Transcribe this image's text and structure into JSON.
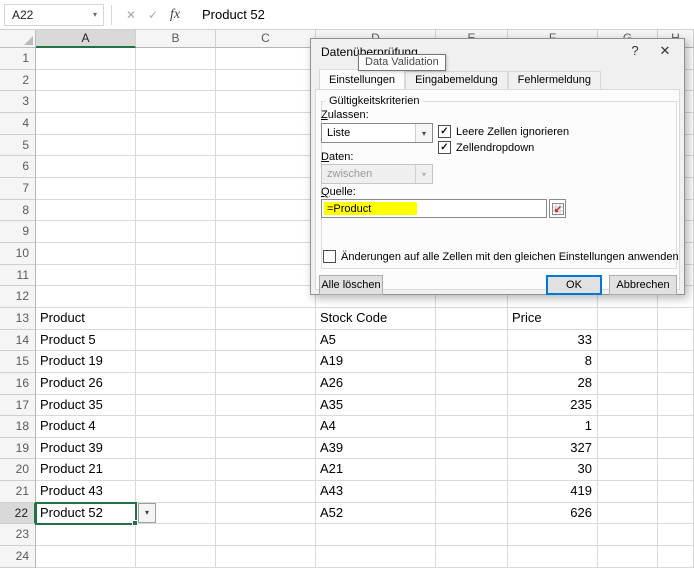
{
  "icons": {
    "dropdown_arrow": "▾",
    "cancel": "✕",
    "enter": "✓",
    "fx": "fx",
    "check": "✓",
    "help": "?",
    "close": "✕"
  },
  "formula_bar": {
    "name_box": "A22",
    "formula": "Product 52"
  },
  "sheet": {
    "col_headers": [
      "A",
      "B",
      "C",
      "D",
      "E",
      "F",
      "G",
      "H"
    ],
    "row_count": 24,
    "selected_cell": "A22",
    "cells": {
      "13": {
        "A": "Product",
        "D": "Stock Code",
        "F": "Price"
      },
      "14": {
        "A": "Product 5",
        "D": "A5",
        "F": "33"
      },
      "15": {
        "A": "Product 19",
        "D": "A19",
        "F": "8"
      },
      "16": {
        "A": "Product 26",
        "D": "A26",
        "F": "28"
      },
      "17": {
        "A": "Product 35",
        "D": "A35",
        "F": "235"
      },
      "18": {
        "A": "Product 4",
        "D": "A4",
        "F": "1"
      },
      "19": {
        "A": "Product 39",
        "D": "A39",
        "F": "327"
      },
      "20": {
        "A": "Product 21",
        "D": "A21",
        "F": "30"
      },
      "21": {
        "A": "Product 43",
        "D": "A43",
        "F": "419"
      },
      "22": {
        "A": "Product 52",
        "D": "A52",
        "F": "626"
      }
    }
  },
  "dialog": {
    "title": "Datenüberprüfung",
    "tooltip": "Data Validation",
    "tabs": [
      "Einstellungen",
      "Eingabemeldung",
      "Fehlermeldung"
    ],
    "active_tab": "Einstellungen",
    "group_label": "Gültigkeitskriterien",
    "allow_label": "Zulassen:",
    "allow_value": "Liste",
    "checkbox_ignore_blank": "Leere Zellen ignorieren",
    "ignore_blank_checked": true,
    "checkbox_in_cell_dropdown": "Zellendropdown",
    "in_cell_dropdown_checked": true,
    "data_label": "Daten:",
    "data_value": "zwischen",
    "source_label": "Quelle:",
    "source_value": "=Product",
    "apply_all_label": "Änderungen auf alle Zellen mit den gleichen Einstellungen anwenden",
    "apply_all_checked": false,
    "buttons": {
      "clear_all": "Alle löschen",
      "ok": "OK",
      "cancel": "Abbrechen"
    }
  }
}
